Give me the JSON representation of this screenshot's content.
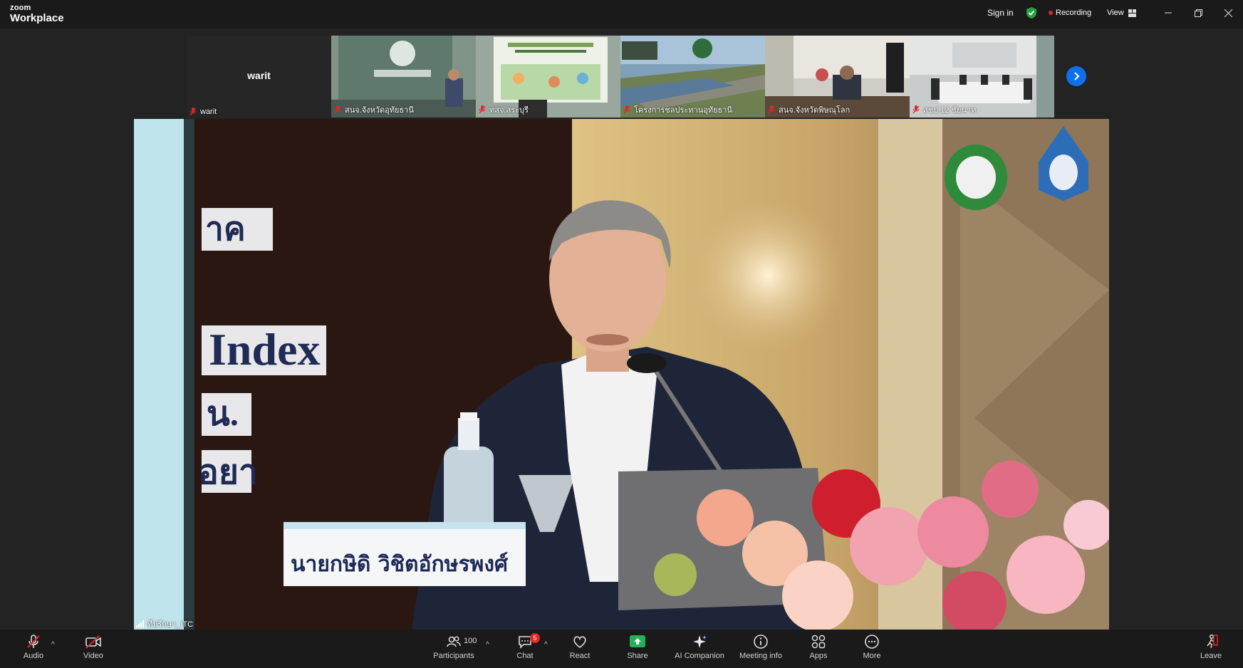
{
  "app": {
    "brand": "zoom",
    "product": "Workplace",
    "sign_in": "Sign in",
    "recording": "Recording",
    "view": "View"
  },
  "gallery": {
    "tiles": [
      {
        "name": "warit",
        "display": "warit"
      },
      {
        "name": "สนจ.จังหวัดอุทัยธานี"
      },
      {
        "name": "ทสจ.สระบุรี"
      },
      {
        "name": "โครงการชลประทานอุทัยธานี"
      },
      {
        "name": "สนจ.จังหวัดพิษณุโลก"
      },
      {
        "name": "สชป.12 ชัยนาท"
      }
    ]
  },
  "main_video": {
    "speaker_label": "ที่ปรึกษา_ITC",
    "nameplate": "นายกษิดิ วิชิตอักษรพงศ์",
    "banner_text": [
      "าค",
      "Index",
      "น.",
      "อยา"
    ]
  },
  "toolbar": {
    "audio": "Audio",
    "video": "Video",
    "participants": "Participants",
    "participants_count": "100",
    "chat": "Chat",
    "chat_badge": "5",
    "react": "React",
    "share": "Share",
    "ai_companion": "AI Companion",
    "meeting_info": "Meeting info",
    "apps": "Apps",
    "more": "More",
    "leave": "Leave"
  },
  "colors": {
    "accent": "#0e71eb",
    "share": "#24b05a",
    "record": "#e02828",
    "muted": "#e02828"
  }
}
